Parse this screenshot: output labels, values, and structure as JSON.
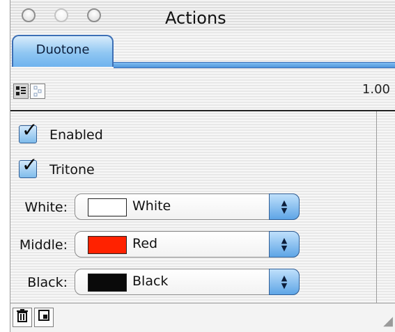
{
  "window": {
    "title": "Actions",
    "buttons": [
      "close-icon",
      "minimize-icon",
      "zoom-icon"
    ]
  },
  "tabs": [
    {
      "label": "Duotone",
      "selected": true
    }
  ],
  "toolbar": {
    "icons": [
      "list-view-icon",
      "mode-icon"
    ],
    "version": "1.00"
  },
  "options": {
    "enabled": {
      "label": "Enabled",
      "checked": true
    },
    "tritone": {
      "label": "Tritone",
      "checked": true
    }
  },
  "colors": {
    "white": {
      "label": "White:",
      "value": "White",
      "swatch": "#ffffff"
    },
    "middle": {
      "label": "Middle:",
      "value": "Red",
      "swatch": "#ff2200"
    },
    "black": {
      "label": "Black:",
      "value": "Black",
      "swatch": "#0a0a0a"
    }
  },
  "footer": {
    "icons": [
      "trash-icon",
      "new-item-icon",
      "resize-grip-icon"
    ]
  }
}
